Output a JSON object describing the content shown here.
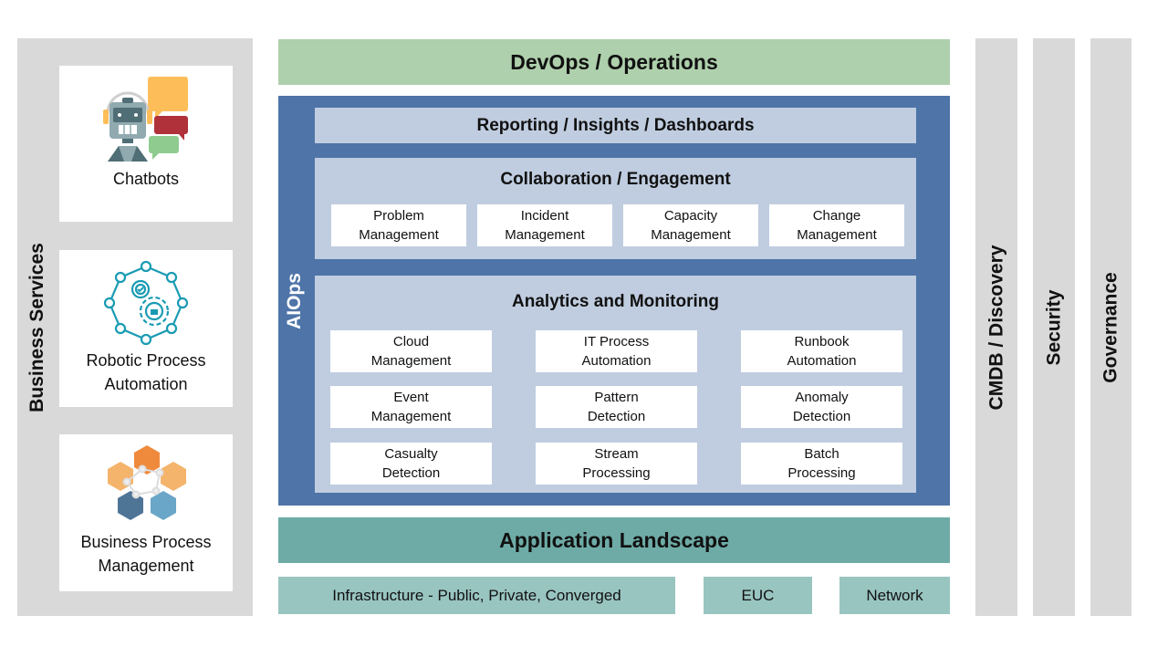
{
  "left_column": {
    "title": "Business Services",
    "cards": [
      {
        "label": "Chatbots",
        "icon": "chatbot-robot-icon"
      },
      {
        "label": "Robotic Process\nAutomation",
        "line1": "Robotic Process",
        "line2": "Automation",
        "icon": "gear-network-icon"
      },
      {
        "label": "Business Process\nManagement",
        "line1": "Business Process",
        "line2": "Management",
        "icon": "hexagon-network-icon"
      }
    ]
  },
  "center": {
    "devops": "DevOps / Operations",
    "aiops_label": "AIOps",
    "reporting": "Reporting / Insights / Dashboards",
    "collaboration": {
      "title": "Collaboration / Engagement",
      "items": [
        "Problem\nManagement",
        "Incident\nManagement",
        "Capacity\nManagement",
        "Change\nManagement"
      ]
    },
    "analytics": {
      "title": "Analytics and Monitoring",
      "items": [
        "Cloud\nManagement",
        "IT Process\nAutomation",
        "Runbook\nAutomation",
        "Event\nManagement",
        "Pattern\nDetection",
        "Anomaly\nDetection",
        "Casualty\nDetection",
        "Stream\nProcessing",
        "Batch\nProcessing"
      ]
    },
    "application_landscape": "Application Landscape",
    "infrastructure": [
      "Infrastructure - Public, Private, Converged",
      "EUC",
      "Network"
    ]
  },
  "right_columns": [
    "CMDB / Discovery",
    "Security",
    "Governance"
  ],
  "colors": {
    "devops": "#aed0ac",
    "aiops": "#4e74a8",
    "panel": "#c0cde0",
    "app_landscape": "#6eaba6",
    "infra": "#99c5c1",
    "column_gray": "#d9d9d9"
  }
}
